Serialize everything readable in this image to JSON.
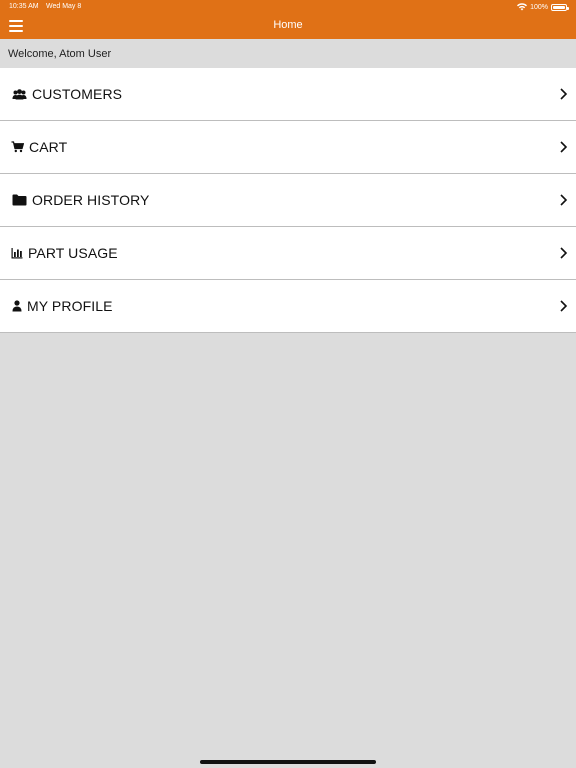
{
  "status": {
    "time": "10:35 AM",
    "date": "Wed May 8",
    "battery": "100%"
  },
  "header": {
    "title": "Home",
    "accent": "#e07116"
  },
  "welcome": "Welcome, Atom User",
  "menu": [
    {
      "label": "CUSTOMERS",
      "icon": "users-icon"
    },
    {
      "label": "CART",
      "icon": "cart-icon"
    },
    {
      "label": "ORDER HISTORY",
      "icon": "folder-icon"
    },
    {
      "label": "PART USAGE",
      "icon": "bar-chart-icon"
    },
    {
      "label": "MY PROFILE",
      "icon": "user-icon"
    }
  ]
}
